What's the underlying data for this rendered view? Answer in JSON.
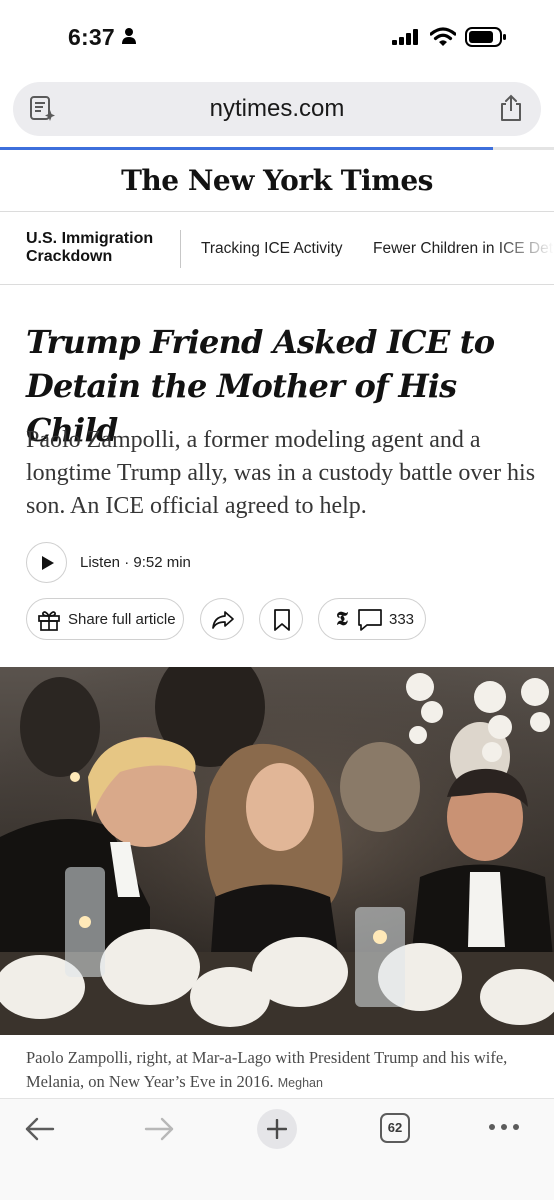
{
  "status_bar": {
    "time": "6:37"
  },
  "browser": {
    "url": "nytimes.com",
    "load_progress": 0.89,
    "tab_count": "62"
  },
  "masthead": {
    "logo_text": "The New York Times"
  },
  "section_nav": {
    "section_title": "U.S. Immigration Crackdown",
    "links": [
      "Tracking ICE Activity",
      "Fewer Children in ICE Det"
    ]
  },
  "article": {
    "headline": "Trump Friend Asked ICE to Detain the Mother of His Child",
    "summary": "Paolo Zampolli, a former modeling agent and a longtime Trump ally, was in a custody battle over his son. An ICE official agreed to help.",
    "listen_label": "Listen · 9:52 min",
    "share_label": "Share full article",
    "comment_count": "333",
    "caption": "Paolo Zampolli, right, at Mar-a-Lago with President Trump and his wife, Melania, on New Year’s Eve in 2016.",
    "caption_credit": "Meghan"
  },
  "icons": {
    "status": [
      "person-icon",
      "signal-icon",
      "wifi-icon",
      "battery-icon"
    ],
    "url_bar": [
      "reader-icon",
      "share-icon"
    ],
    "article_actions": [
      "play-icon",
      "gift-icon",
      "forward-icon",
      "bookmark-icon",
      "nyt-t-icon",
      "comment-icon"
    ],
    "toolbar": [
      "back-arrow-icon",
      "forward-arrow-icon",
      "plus-icon",
      "more-icon"
    ]
  },
  "colors": {
    "progress": "#3d6fdc",
    "text": "#121212",
    "toolbar_bg": "#f9f9f9"
  }
}
